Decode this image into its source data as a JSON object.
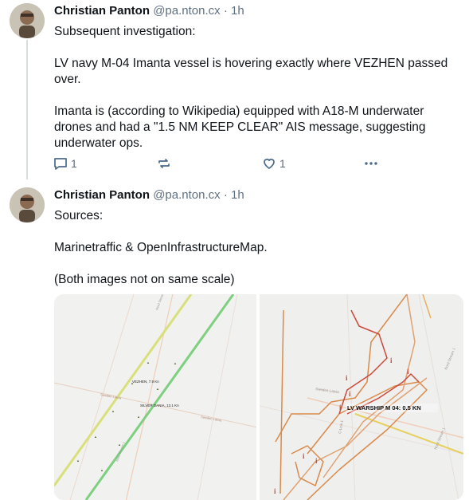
{
  "posts": [
    {
      "author": "Christian Panton",
      "handle": "@pa.nton.cx",
      "separator": "·",
      "time": "1h",
      "paragraphs": [
        "Subsequent investigation:",
        "LV navy M-04 Imanta vessel is hovering exactly where VEZHEN passed over.",
        "Imanta is (according to Wikipedia) equipped with A18-M underwater drones and had a \"1.5 NM KEEP CLEAR\" AIS message, suggesting underwater ops."
      ],
      "actions": {
        "reply_icon": "reply-icon",
        "reply_count": "1",
        "repost_icon": "repost-icon",
        "like_icon": "heart-icon",
        "like_count": "1",
        "more_icon": "more-horizontal-icon"
      }
    },
    {
      "author": "Christian Panton",
      "handle": "@pa.nton.cx",
      "separator": "·",
      "time": "1h",
      "paragraphs": [
        "Sources:",
        "Marinetraffic & OpenInfrastructureMap.",
        "(Both images not on same scale)"
      ],
      "images": {
        "left": {
          "ship_labels": [
            "VEZHEN, 7.9 Kn",
            "SILVER DANIA, 13.1 Kn"
          ],
          "road_labels": [
            "Sweden-Latvia",
            "Sweden-Latvia",
            "Nord Stream 1",
            "Nord Stream 1"
          ],
          "colors": {
            "vezhen_track": "#d9e07a",
            "dania_track": "#7fcf80",
            "cable": "#f0c9b0"
          }
        },
        "right": {
          "ship_label": "LV WARSHIP M 04: 0.5 KN",
          "info_marker": "i",
          "cable_labels": [
            "Sweden-Latvia",
            "C-Lion 1",
            "Nord Stream 1",
            "Nord Stream 1"
          ],
          "colors": {
            "track_main": "#d98a4a",
            "track_alt": "#e0a070",
            "track_red": "#cc4a3a",
            "cable": "#f0c9b0",
            "yellow": "#e6d060"
          }
        }
      }
    }
  ]
}
